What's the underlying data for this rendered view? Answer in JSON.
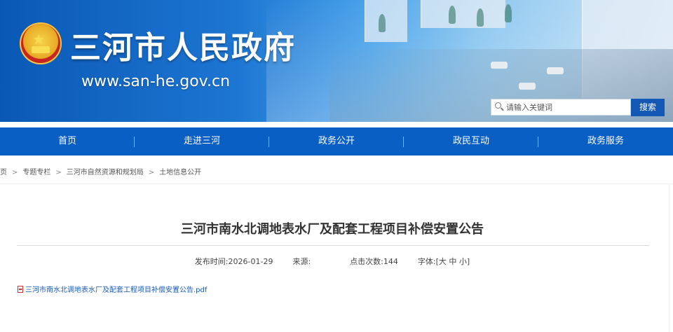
{
  "header": {
    "site_name": "三河市人民政府",
    "site_url": "www.san-he.gov.cn",
    "search": {
      "placeholder": "请输入关键词",
      "button_label": "搜索"
    }
  },
  "nav": {
    "items": [
      {
        "label": "首页"
      },
      {
        "label": "走进三河"
      },
      {
        "label": "政务公开"
      },
      {
        "label": "政民互动"
      },
      {
        "label": "政务服务"
      }
    ]
  },
  "breadcrumb": {
    "items": [
      "页",
      "专题专栏",
      "三河市自然资源和规划局",
      "土地信息公开"
    ],
    "separator": ">"
  },
  "article": {
    "title": "三河市南水北调地表水厂及配套工程项目补偿安置公告",
    "publish_label": "发布时间:",
    "publish_date": "2026-01-29",
    "source_label": "来源:",
    "source_value": "",
    "clicks_label": "点击次数:",
    "clicks_value": "144",
    "font_label": "字体:",
    "font_open": "[",
    "font_large": "大",
    "font_medium": "中",
    "font_small": "小",
    "font_close": "]",
    "attachment": "三河市南水北调地表水厂及配套工程项目补偿安置公告.pdf"
  },
  "colors": {
    "nav_bg": "#0a5fc4",
    "search_button_bg": "#1458b6",
    "link": "#1a5bb5"
  },
  "icons": [
    "national-emblem-icon",
    "search-icon",
    "pdf-file-icon"
  ]
}
